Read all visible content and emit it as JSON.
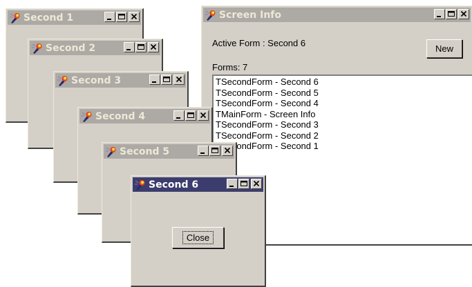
{
  "windows": [
    {
      "title": "Second 1"
    },
    {
      "title": "Second 2"
    },
    {
      "title": "Second 3"
    },
    {
      "title": "Second 4"
    },
    {
      "title": "Second 5"
    },
    {
      "title": "Second 6",
      "button_label": "Close"
    }
  ],
  "screen_info": {
    "title": "Screen Info",
    "active_form_label": "Active Form : Second 6",
    "forms_count_label": "Forms: 7",
    "new_button_label": "New",
    "forms": [
      "TSecondForm - Second 6",
      "TSecondForm - Second 5",
      "TSecondForm - Second 4",
      "TMainForm - Screen Info",
      "TSecondForm - Second 3",
      "TSecondForm - Second 2",
      "TSecondForm - Second 1"
    ]
  },
  "colors": {
    "active_titlebar": "#3c3d6e",
    "inactive_titlebar": "#ada9a4",
    "window_face": "#d4d0c8"
  },
  "icons": {
    "app_icon": "delphi-torch-icon",
    "minimize": "minimize-icon",
    "maximize": "maximize-icon",
    "close": "close-icon"
  }
}
